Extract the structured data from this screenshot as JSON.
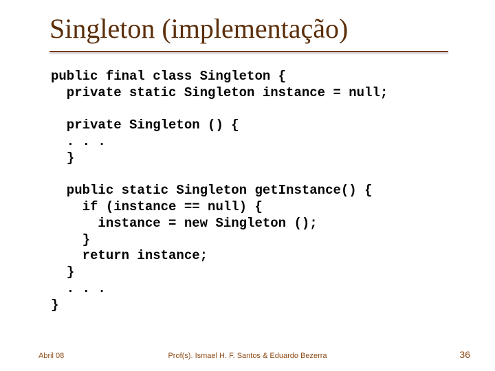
{
  "title": "Singleton (implementação)",
  "code": "public final class Singleton {\n  private static Singleton instance = null;\n\n  private Singleton () {\n  . . .\n  }\n\n  public static Singleton getInstance() {\n    if (instance == null) {\n      instance = new Singleton ();\n    }\n    return instance;\n  }\n  . . .\n}",
  "footer": {
    "left": "Abril 08",
    "center": "Prof(s). Ismael H. F. Santos & Eduardo Bezerra",
    "right": "36"
  }
}
